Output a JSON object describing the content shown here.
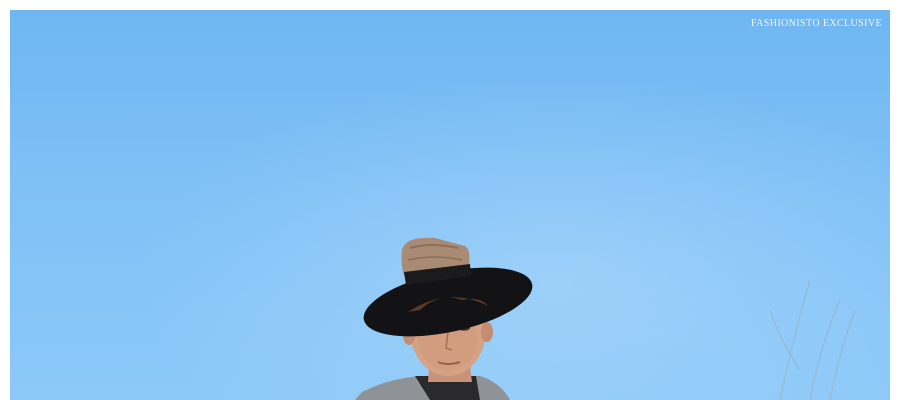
{
  "photo": {
    "watermark": "FASHIONISTO EXCLUSIVE"
  }
}
